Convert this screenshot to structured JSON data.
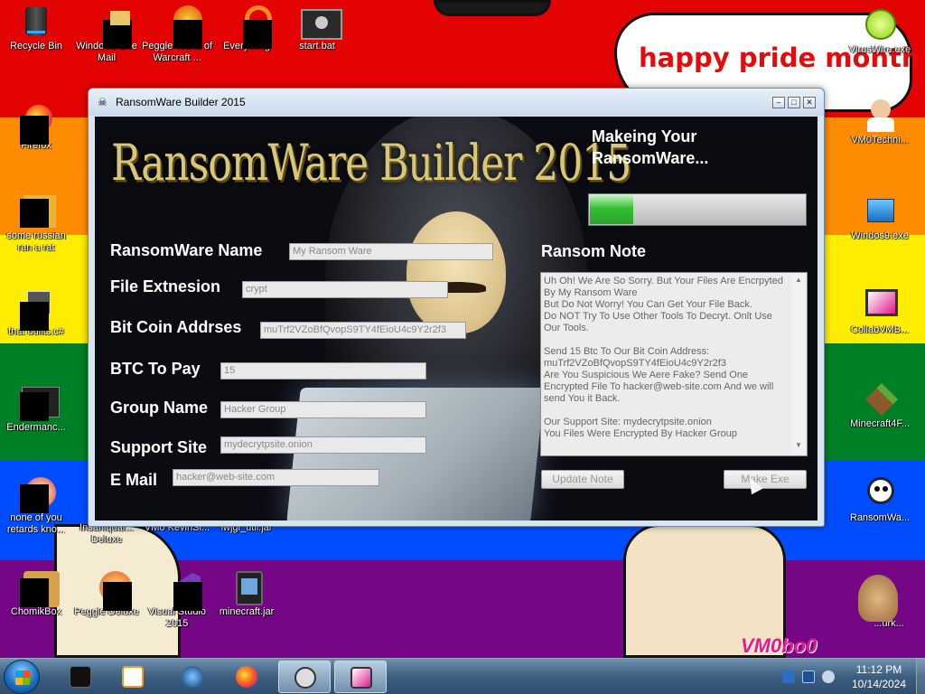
{
  "wallpaper": {
    "speech_text": "happy pride month",
    "watermark_text": "VM0bo0"
  },
  "desktop_icons": [
    {
      "label": "Recycle Bin",
      "icon": "recycle-bin-icon"
    },
    {
      "label": "Windows Live Mail",
      "icon": "windows-live-mail-icon"
    },
    {
      "label": "Peggle World of Warcraft ...",
      "icon": "peggle-wow-icon"
    },
    {
      "label": "Everything",
      "icon": "everything-search-icon"
    },
    {
      "label": "start.bat",
      "icon": "batch-file-icon"
    },
    {
      "label": "Firefox",
      "icon": "firefox-icon"
    },
    {
      "label": "some russian ran a rat",
      "icon": "shortcut-icon"
    },
    {
      "label": "that builts.c#",
      "icon": "shortcut-icon"
    },
    {
      "label": "Endermanc...",
      "icon": "shortcut-icon"
    },
    {
      "label": "none of you retards kno...",
      "icon": "shortcut-icon"
    },
    {
      "label": "ChomikBox",
      "icon": "chomikbox-icon"
    },
    {
      "label": "Peggle Deluxe",
      "icon": "peggle-icon"
    },
    {
      "label": "Visual Studio 2015",
      "icon": "visual-studio-icon"
    },
    {
      "label": "minecraft.jar",
      "icon": "jar-file-icon"
    },
    {
      "label": "VirusWire.exe",
      "icon": "lime-icon"
    },
    {
      "label": "VM0Techni...",
      "icon": "doctor-icon"
    },
    {
      "label": "Windos9.exe",
      "icon": "installer-icon"
    },
    {
      "label": "CollabVMB...",
      "icon": "monitor-icon"
    },
    {
      "label": "Minecraft4F...",
      "icon": "minecraft-block-icon"
    },
    {
      "label": "RansomWa...",
      "icon": "skull-icon"
    },
    {
      "label": "Insaniquar... Deluxe",
      "icon": "shortcut-icon"
    },
    {
      "label": "VM0 KevinSi...",
      "icon": "shortcut-icon"
    },
    {
      "label": "lwjgl_util.jar",
      "icon": "jar-file-icon"
    },
    {
      "label": "...urk...",
      "icon": "shortcut-icon"
    }
  ],
  "window": {
    "title": "RansomWare Builder 2015",
    "app_title": "RansomWare Builder 2015",
    "status": "Makeing Your RansomWare...",
    "progress_fraction": 0.2,
    "labels": {
      "name": "RansomWare Name",
      "extension": "File Extnesion",
      "btc_address": "Bit Coin Addrses",
      "btc_amount": "BTC To Pay",
      "group": "Group Name",
      "site": "Support Site",
      "email": "E Mail",
      "note": "Ransom Note"
    },
    "values": {
      "name": "My Ransom Ware",
      "extension": "crypt",
      "btc_address": "muTrf2VZoBfQvopS9TY4fEioU4c9Y2r2f3",
      "btc_amount": "15",
      "group": "Hacker Group",
      "site": "mydecrytpsite.onion",
      "email": "hacker@web-site.com"
    },
    "note_text": "Uh Oh! We Are So Sorry. But Your Files Are Encrpyted By My Ransom Ware\nBut Do Not Worry! You Can Get Your File Back.\nDo NOT Try To Use Other Tools To Decryt. Onlt Use Our Tools.\n\nSend 15 Btc To Our Bit Coin Address:\nmuTrf2VZoBfQvopS9TY4fEioU4c9Y2r2f3\nAre You Suspicious We Aere Fake? Send One Encrypted File To hacker@web-site.com And we will send You it Back.\n\nOur Support Site: mydecrytpsite.onion\nYou Files Were Encrypted By Hacker Group",
    "buttons": {
      "update_note": "Update Note",
      "make_exe": "Make Exe"
    }
  },
  "taskbar": {
    "time": "11:12 PM",
    "date": "10/14/2024",
    "items": [
      "black-box-app-icon",
      "media-player-icon",
      "globe-browser-icon",
      "firefox-icon",
      "ransomware-builder-icon",
      "collabvm-monitor-icon"
    ]
  }
}
